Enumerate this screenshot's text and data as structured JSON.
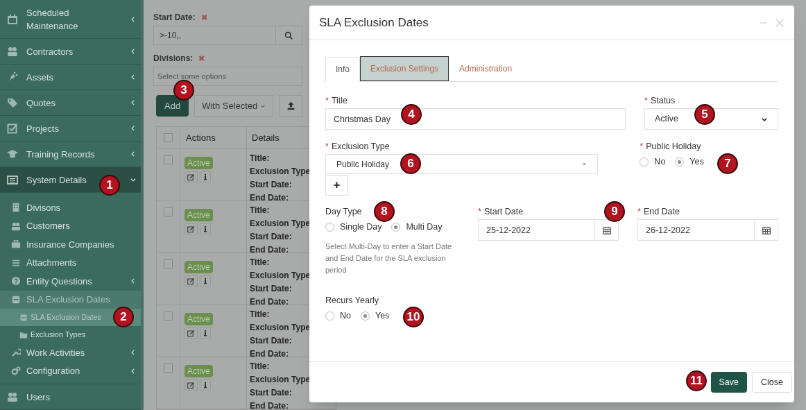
{
  "sidebar": {
    "items": [
      {
        "label": "Scheduled Maintenance",
        "expanded": false,
        "selected": false,
        "has_arrow": true
      },
      {
        "label": "Contractors",
        "expanded": false,
        "selected": false,
        "has_arrow": true
      },
      {
        "label": "Assets",
        "expanded": false,
        "selected": false,
        "has_arrow": true
      },
      {
        "label": "Quotes",
        "expanded": false,
        "selected": false,
        "has_arrow": true
      },
      {
        "label": "Projects",
        "expanded": false,
        "selected": false,
        "has_arrow": true
      },
      {
        "label": "Training Records",
        "expanded": false,
        "selected": false,
        "has_arrow": true
      },
      {
        "label": "System Details",
        "expanded": true,
        "selected": true,
        "has_arrow": true,
        "children": [
          {
            "label": "Divisons",
            "expanded": false,
            "selected": false,
            "has_arrow": false
          },
          {
            "label": "Customers",
            "expanded": false,
            "selected": false,
            "has_arrow": false
          },
          {
            "label": "Insurance Companies",
            "expanded": false,
            "selected": false,
            "has_arrow": false
          },
          {
            "label": "Attachments",
            "expanded": false,
            "selected": false,
            "has_arrow": false
          },
          {
            "label": "Entity Questions",
            "expanded": false,
            "selected": false,
            "has_arrow": true
          },
          {
            "label": "SLA Exclusion Dates",
            "expanded": true,
            "selected": true,
            "has_arrow": false,
            "children": [
              {
                "label": "SLA Exclusion Dates",
                "selected": true
              },
              {
                "label": "Exclusion Types",
                "selected": false
              }
            ]
          },
          {
            "label": "Work Activities",
            "expanded": false,
            "selected": false,
            "has_arrow": true
          },
          {
            "label": "Configuration",
            "expanded": false,
            "selected": false,
            "has_arrow": true
          }
        ]
      },
      {
        "label": "Users",
        "expanded": false,
        "selected": false,
        "has_arrow": false
      }
    ]
  },
  "filters": [
    {
      "label": "Start Date:",
      "clear": "✖",
      "value": ">-10,,",
      "kind": "search"
    },
    {
      "label": "Divisions:",
      "clear": "✖",
      "placeholder": "Select some options",
      "kind": "select"
    }
  ],
  "toolbar": {
    "add": "Add",
    "with_selected": "With Selected"
  },
  "table": {
    "header_checked": false,
    "columns": [
      "Actions",
      "Details"
    ],
    "rows": [
      {
        "checked": false,
        "status": "Active",
        "details": [
          "Title:",
          "Exclusion Type",
          "Start Date:",
          "End Date:"
        ]
      },
      {
        "checked": false,
        "status": "Active",
        "details": [
          "Title:",
          "Exclusion Type",
          "Start Date:",
          "End Date:"
        ]
      },
      {
        "checked": false,
        "status": "Active",
        "details": [
          "Title:",
          "Exclusion Type",
          "Start Date:",
          "End Date:"
        ]
      },
      {
        "checked": false,
        "status": "Active",
        "details": [
          "Title:",
          "Exclusion Type",
          "Start Date:",
          "End Date:"
        ]
      },
      {
        "checked": false,
        "status": "Active",
        "details": [
          "Title:",
          "Exclusion Type",
          "Start Date:",
          "End Date:"
        ]
      }
    ]
  },
  "modal": {
    "title": "SLA Exclusion Dates",
    "tabs": [
      {
        "label": "Info",
        "selected": true,
        "focused": false
      },
      {
        "label": "Exclusion Settings",
        "selected": false,
        "focused": true
      },
      {
        "label": "Administration",
        "selected": false,
        "focused": false
      }
    ],
    "title_field": {
      "label": "Title",
      "required": "*",
      "value": "Christmas Day"
    },
    "status_field": {
      "label": "Status",
      "required": "*",
      "value": "Active"
    },
    "exclusion_type": {
      "label": "Exclusion Type",
      "required": "*",
      "value": "Public Holiday",
      "add": "+"
    },
    "public_holiday": {
      "label": "Public Holiday",
      "required": "*",
      "options": [
        {
          "label": "No",
          "selected": false
        },
        {
          "label": "Yes",
          "selected": true
        }
      ]
    },
    "day_type": {
      "label": "Day Type",
      "options": [
        {
          "label": "Single Day",
          "selected": false
        },
        {
          "label": "Multi Day",
          "selected": true
        }
      ],
      "help": "Select Multi-Day to enter a Start Date and End Date for the SLA exclusion period"
    },
    "start_date": {
      "label": "Start Date",
      "required": "*",
      "value": "25-12-2022"
    },
    "end_date": {
      "label": "End Date",
      "required": "*",
      "value": "26-12-2022"
    },
    "recurs_yearly": {
      "label": "Recurs Yearly",
      "options": [
        {
          "label": "No",
          "selected": false
        },
        {
          "label": "Yes",
          "selected": true
        }
      ]
    },
    "buttons": {
      "save": "Save",
      "close": "Close"
    }
  },
  "callouts": [
    "1",
    "2",
    "3",
    "4",
    "5",
    "6",
    "7",
    "8",
    "9",
    "10",
    "11"
  ]
}
